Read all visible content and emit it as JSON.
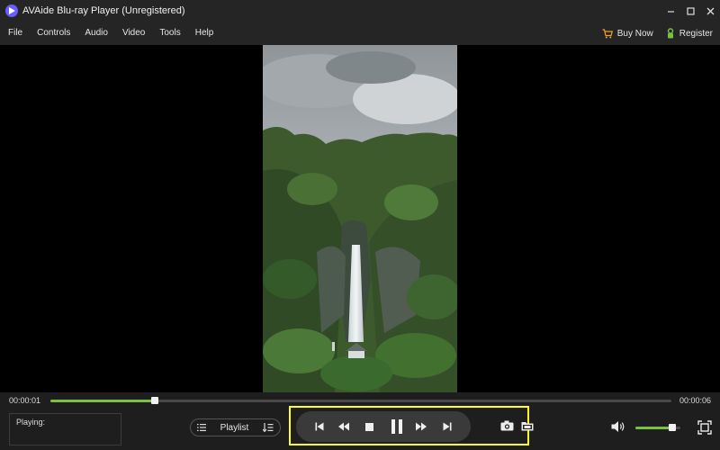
{
  "window": {
    "title": "AVAide Blu-ray Player (Unregistered)",
    "controls": [
      "minimize-icon",
      "maximize-icon",
      "close-icon"
    ]
  },
  "menu": {
    "items": [
      "File",
      "Controls",
      "Audio",
      "Video",
      "Tools",
      "Help"
    ],
    "buy_now": "Buy Now",
    "register": "Register"
  },
  "player": {
    "current_time": "00:00:01",
    "total_time": "00:00:06",
    "progress_fraction": 0.168,
    "status_label": "Playing:",
    "playlist_label": "Playlist",
    "volume_fraction": 0.82
  },
  "colors": {
    "accent_green": "#79c043",
    "highlight_yellow": "#ffff22",
    "logo_purple": "#6a5cff",
    "buy_orange": "#f0a030"
  }
}
